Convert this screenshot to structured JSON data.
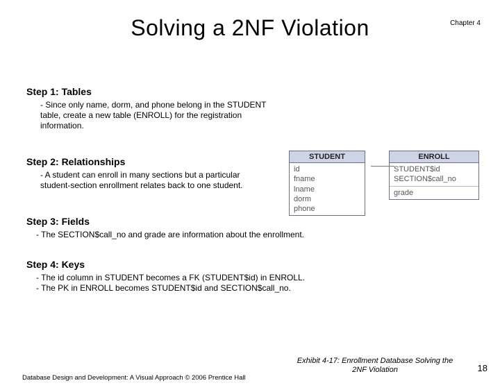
{
  "chapter": "Chapter 4",
  "title": "Solving a 2NF Violation",
  "steps": {
    "s1": {
      "label": "Step 1: Tables",
      "body": "- Since only name, dorm, and phone belong in the STUDENT table, create a new table (ENROLL) for the registration information."
    },
    "s2": {
      "label": "Step 2: Relationships",
      "body": "- A student can enroll in many sections but a particular student-section enrollment relates back to one student."
    },
    "s3": {
      "label": "Step 3: Fields",
      "body": "- The SECTION$call_no and grade are information about the enrollment."
    },
    "s4": {
      "label": "Step 4: Keys",
      "body1": "- The id column in STUDENT becomes a FK (STUDENT$id) in ENROLL.",
      "body2": "- The PK in ENROLL becomes STUDENT$id and SECTION$call_no."
    }
  },
  "diagram": {
    "student": {
      "name": "STUDENT",
      "fields": [
        "id",
        "fname",
        "lname",
        "dorm",
        "phone"
      ]
    },
    "enroll": {
      "name": "ENROLL",
      "keys": [
        "STUDENT$id",
        "SECTION$call_no"
      ],
      "fields": [
        "grade"
      ]
    }
  },
  "caption": "Exhibit 4-17: Enrollment Database Solving the 2NF Violation",
  "footer": "Database Design and Development: A Visual Approach   © 2006 Prentice Hall",
  "page": "18"
}
